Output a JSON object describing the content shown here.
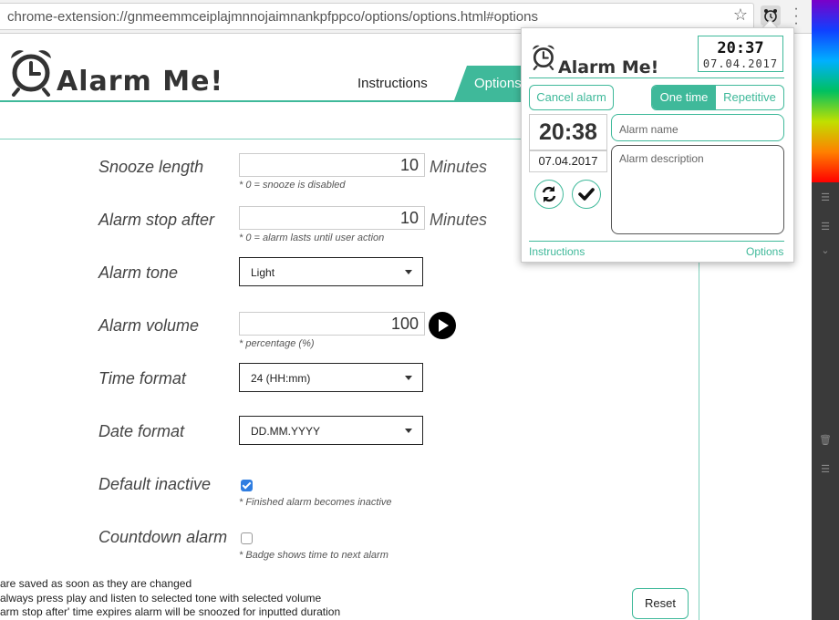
{
  "browser": {
    "url": "chrome-extension://gnmeemmceiplajmnnojaimnankpfppco/options/options.html#options",
    "bookmark_icon": "star-icon",
    "extension_icon": "alarm-clock-icon",
    "menu_icon": "kebab-menu-icon"
  },
  "header": {
    "logo_text": "Alarm Me!",
    "nav": {
      "instructions": "Instructions",
      "options": "Options"
    }
  },
  "options": {
    "snooze": {
      "label": "Snooze length",
      "value": "10",
      "unit": "Minutes",
      "hint": "* 0 = snooze is disabled"
    },
    "stop_after": {
      "label": "Alarm stop after",
      "value": "10",
      "unit": "Minutes",
      "hint": "* 0 = alarm lasts until user action"
    },
    "tone": {
      "label": "Alarm tone",
      "value": "Light"
    },
    "volume": {
      "label": "Alarm volume",
      "value": "100",
      "hint": "* percentage (%)"
    },
    "time_format": {
      "label": "Time format",
      "value": "24 (HH:mm)"
    },
    "date_format": {
      "label": "Date format",
      "value": "DD.MM.YYYY"
    },
    "default_inactive": {
      "label": "Default inactive",
      "checked": true,
      "hint": "* Finished alarm becomes inactive"
    },
    "countdown": {
      "label": "Countdown alarm",
      "checked": false,
      "hint": "* Badge shows time to next alarm"
    }
  },
  "notes": [
    "are saved as soon as they are changed",
    "always press play and listen to selected tone with selected volume",
    "arm stop after' time expires alarm will be snoozed for inputted duration"
  ],
  "reset_label": "Reset",
  "popup": {
    "logo_text": "Alarm Me!",
    "clock_time": "20:37",
    "clock_date": "07.04.2017",
    "cancel_label": "Cancel alarm",
    "one_time_label": "One time",
    "repetitive_label": "Repetitive",
    "alarm_time_hours": "20",
    "alarm_time_minutes": "38",
    "alarm_date": "07.04.2017",
    "name_placeholder": "Alarm name",
    "description_placeholder": "Alarm description",
    "instructions_link": "Instructions",
    "options_link": "Options"
  },
  "colors": {
    "accent": "#3fb99a",
    "checkbox": "#2f7de1"
  }
}
